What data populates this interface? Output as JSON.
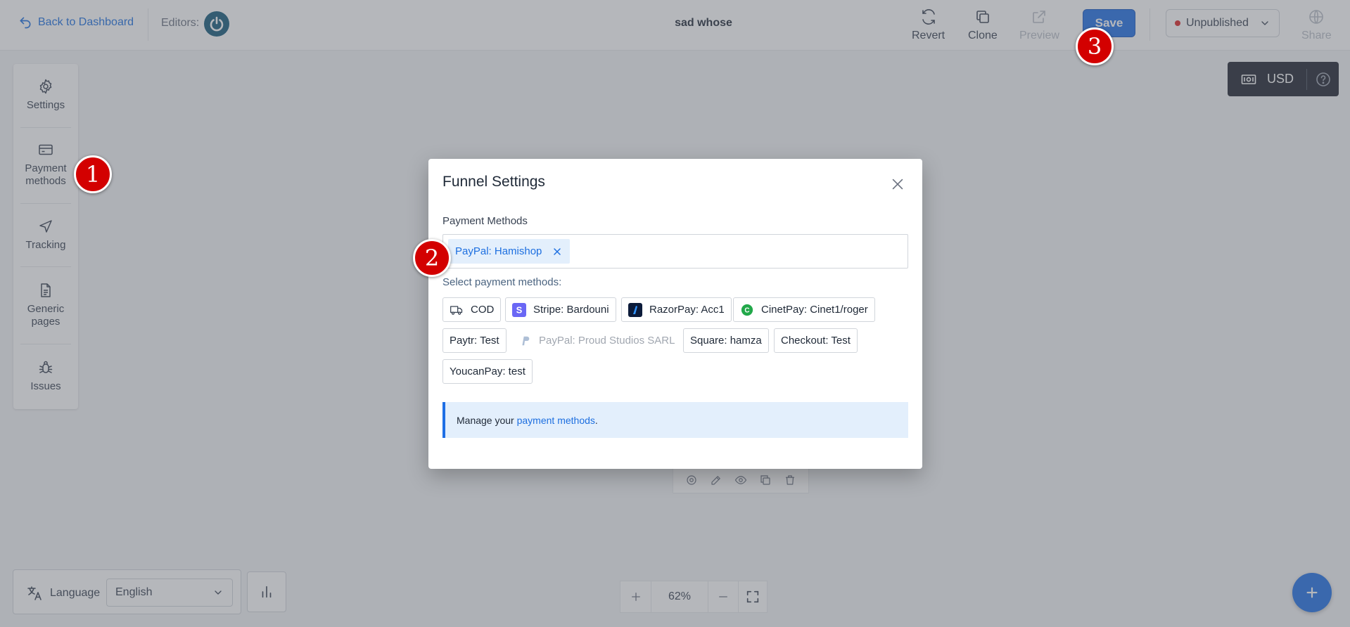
{
  "topbar": {
    "back_label": "Back to Dashboard",
    "editors_label": "Editors:",
    "funnel_name": "sad whose",
    "revert_label": "Revert",
    "clone_label": "Clone",
    "preview_label": "Preview",
    "save_label": "Save",
    "status_label": "Unpublished",
    "share_label": "Share"
  },
  "currency": {
    "code": "USD"
  },
  "sidebar": {
    "items": [
      {
        "label": "Settings",
        "icon": "gear-icon"
      },
      {
        "label": "Payment methods",
        "icon": "credit-card-icon"
      },
      {
        "label": "Tracking",
        "icon": "navigation-arrow-icon"
      },
      {
        "label": "Generic pages",
        "icon": "document-icon"
      },
      {
        "label": "Issues",
        "icon": "bug-icon"
      }
    ]
  },
  "bottom": {
    "language_label": "Language",
    "language_value": "English",
    "zoom_value": "62%"
  },
  "modal": {
    "title": "Funnel Settings",
    "field_label": "Payment Methods",
    "selected": [
      "PayPal: Hamishop"
    ],
    "select_hint": "Select payment methods:",
    "options": [
      {
        "label": "COD",
        "icon": "truck-icon",
        "disabled": false
      },
      {
        "label": "Stripe: Bardouni",
        "icon": "stripe-icon",
        "disabled": false
      },
      {
        "label": "RazorPay: Acc1",
        "icon": "razorpay-icon",
        "disabled": false
      },
      {
        "label": "CinetPay: Cinet1/roger",
        "icon": "cinetpay-icon",
        "disabled": false
      },
      {
        "label": "Paytr: Test",
        "icon": "",
        "disabled": false
      },
      {
        "label": "PayPal: Proud Studios SARL",
        "icon": "paypal-icon",
        "disabled": true
      },
      {
        "label": "Square: hamza",
        "icon": "",
        "disabled": false
      },
      {
        "label": "Checkout: Test",
        "icon": "",
        "disabled": false
      },
      {
        "label": "YoucanPay: test",
        "icon": "",
        "disabled": false
      }
    ],
    "info_prefix": "Manage your ",
    "info_link": "payment methods",
    "info_suffix": "."
  },
  "markers": [
    "1",
    "2",
    "3"
  ],
  "colors": {
    "accent": "#1f6fe5",
    "marker": "#d30000",
    "status_dot": "#dc2626",
    "info_bg": "#e3effc"
  }
}
